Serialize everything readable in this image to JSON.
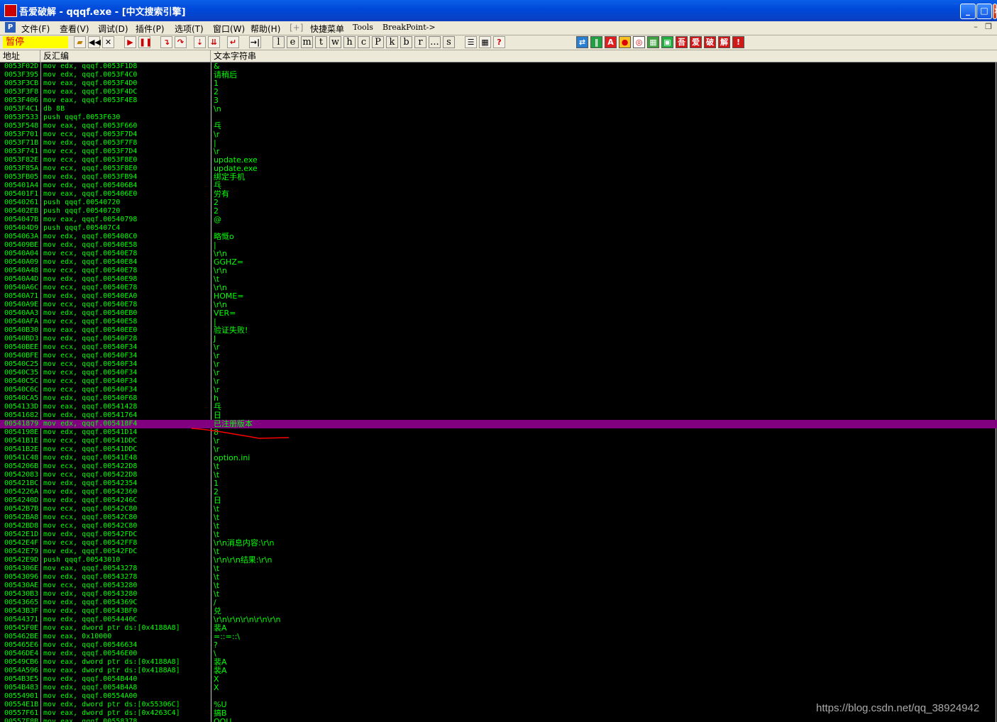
{
  "window": {
    "title": "吾爱破解 - qqqf.exe - [中文搜索引擎]",
    "icon_text": "吾爱破解"
  },
  "window_buttons": {
    "minimize": "_",
    "maximize": "□",
    "close": "×"
  },
  "menu": {
    "p_icon": "P",
    "items": [
      "文件(F)",
      "查看(V)",
      "调试(D)",
      "插件(P)",
      "选项(T)",
      "窗口(W)",
      "帮助(H)",
      "[+]",
      "快捷菜单",
      "Tools",
      "BreakPoint->"
    ],
    "mdi_min": "–",
    "mdi_restore": "❐"
  },
  "toolbar": {
    "status": "暂停",
    "buttons": [
      "open-icon",
      "rewind-icon",
      "close-icon",
      "run-icon",
      "pause-icon",
      "step-into-icon",
      "step-over-icon",
      "trace-into-icon",
      "trace-over-icon",
      "execute-till-return-icon",
      "goto-icon"
    ],
    "letters": [
      "l",
      "e",
      "m",
      "t",
      "w",
      "h",
      "c",
      "P",
      "k",
      "b",
      "r",
      "...",
      "s"
    ],
    "list_icons": [
      "list-icon",
      "memory-map-icon",
      "help-icon"
    ],
    "plugin_icons": [
      {
        "name": "refresh-icon",
        "text": "⇄",
        "bg": "#2a7fd0"
      },
      {
        "name": "patch-icon",
        "text": "‖",
        "bg": "#20a040"
      },
      {
        "name": "a-icon",
        "text": "A",
        "bg": "#e02020"
      },
      {
        "name": "record-icon",
        "text": "●",
        "bg": "#f8c020"
      },
      {
        "name": "target-icon",
        "text": "◎",
        "bg": "#ffffff"
      },
      {
        "name": "grid-icon",
        "text": "▦",
        "bg": "#40a040"
      },
      {
        "name": "window-icon",
        "text": "▣",
        "bg": "#20b040"
      },
      {
        "name": "wu-icon",
        "text": "吾",
        "bg": "#d01818"
      },
      {
        "name": "ai-icon",
        "text": "爱",
        "bg": "#d01818"
      },
      {
        "name": "po-icon",
        "text": "破",
        "bg": "#d01818"
      },
      {
        "name": "jie-icon",
        "text": "解",
        "bg": "#d01818"
      },
      {
        "name": "bang-icon",
        "text": "!",
        "bg": "#d01818"
      }
    ]
  },
  "columns": {
    "addr": "地址",
    "disasm": "反汇编",
    "string": "文本字符串"
  },
  "selected_row": 42,
  "colors": {
    "text": "#00ff00",
    "selection": "#800080",
    "annotation": "#ff0000"
  },
  "rows": [
    {
      "addr": "0053F02D",
      "dis": "mov edx, qqqf.0053F1D8",
      "str": "&"
    },
    {
      "addr": "0053F395",
      "dis": "mov edx, qqqf.0053F4C0",
      "str": "请稍后"
    },
    {
      "addr": "0053F3CB",
      "dis": "mov eax, qqqf.0053F4D0",
      "str": "1"
    },
    {
      "addr": "0053F3F8",
      "dis": "mov eax, qqqf.0053F4DC",
      "str": "2"
    },
    {
      "addr": "0053F406",
      "dis": "mov eax, qqqf.0053F4E8",
      "str": "3"
    },
    {
      "addr": "0053F4C1",
      "dis": "db 8B",
      "str": "\\n"
    },
    {
      "addr": "0053F533",
      "dis": "push qqqf.0053F630",
      "str": ""
    },
    {
      "addr": "0053F548",
      "dis": "mov eax, qqqf.0053F660",
      "str": "乓"
    },
    {
      "addr": "0053F701",
      "dis": "mov ecx, qqqf.0053F7D4",
      "str": "\\r"
    },
    {
      "addr": "0053F71B",
      "dis": "mov edx, qqqf.0053F7F8",
      "str": "|"
    },
    {
      "addr": "0053F741",
      "dis": "mov ecx, qqqf.0053F7D4",
      "str": "\\r"
    },
    {
      "addr": "0053F82E",
      "dis": "mov ecx, qqqf.0053F8E0",
      "str": "update.exe"
    },
    {
      "addr": "0053F85A",
      "dis": "mov ecx, qqqf.0053F8E0",
      "str": "update.exe"
    },
    {
      "addr": "0053FB05",
      "dis": "mov edx, qqqf.0053FB94",
      "str": "绑定手机"
    },
    {
      "addr": "005401A4",
      "dis": "mov edx, qqqf.005406B4",
      "str": "乓"
    },
    {
      "addr": "005401F1",
      "dis": "mov eax, qqqf.005406E0",
      "str": "労有"
    },
    {
      "addr": "00540261",
      "dis": "push qqqf.00540720",
      "str": "2"
    },
    {
      "addr": "005402EB",
      "dis": "push qqqf.00540720",
      "str": "2"
    },
    {
      "addr": "0054047B",
      "dis": "mov eax, qqqf.00540798",
      "str": "@"
    },
    {
      "addr": "005404D9",
      "dis": "push qqqf.005407C4",
      "str": ""
    },
    {
      "addr": "0054063A",
      "dis": "mov edx, qqqf.005408C0",
      "str": "略慨o"
    },
    {
      "addr": "005409BE",
      "dis": "mov edx, qqqf.00540E58",
      "str": "|"
    },
    {
      "addr": "00540A04",
      "dis": "mov ecx, qqqf.00540E78",
      "str": "\\r\\n"
    },
    {
      "addr": "00540A09",
      "dis": "mov edx, qqqf.00540E84",
      "str": "GGHZ="
    },
    {
      "addr": "00540A48",
      "dis": "mov ecx, qqqf.00540E78",
      "str": "\\r\\n"
    },
    {
      "addr": "00540A4D",
      "dis": "mov edx, qqqf.00540E98",
      "str": "\\t"
    },
    {
      "addr": "00540A6C",
      "dis": "mov ecx, qqqf.00540E78",
      "str": "\\r\\n"
    },
    {
      "addr": "00540A71",
      "dis": "mov edx, qqqf.00540EA0",
      "str": "HOME="
    },
    {
      "addr": "00540A9E",
      "dis": "mov ecx, qqqf.00540E78",
      "str": "\\r\\n"
    },
    {
      "addr": "00540AA3",
      "dis": "mov edx, qqqf.00540EB0",
      "str": "VER="
    },
    {
      "addr": "00540AFA",
      "dis": "mov ecx, qqqf.00540E58",
      "str": "|"
    },
    {
      "addr": "00540B30",
      "dis": "mov eax, qqqf.00540EE0",
      "str": "验证失败!"
    },
    {
      "addr": "00540BD3",
      "dis": "mov edx, qqqf.00540F28",
      "str": "J"
    },
    {
      "addr": "00540BEE",
      "dis": "mov ecx, qqqf.00540F34",
      "str": "\\r"
    },
    {
      "addr": "00540BFE",
      "dis": "mov ecx, qqqf.00540F34",
      "str": "\\r"
    },
    {
      "addr": "00540C25",
      "dis": "mov ecx, qqqf.00540F34",
      "str": "\\r"
    },
    {
      "addr": "00540C35",
      "dis": "mov ecx, qqqf.00540F34",
      "str": "\\r"
    },
    {
      "addr": "00540C5C",
      "dis": "mov ecx, qqqf.00540F34",
      "str": "\\r"
    },
    {
      "addr": "00540C6C",
      "dis": "mov ecx, qqqf.00540F34",
      "str": "\\r"
    },
    {
      "addr": "00540CA5",
      "dis": "mov edx, qqqf.00540F68",
      "str": "h"
    },
    {
      "addr": "0054133D",
      "dis": "mov eax, qqqf.00541428",
      "str": "乓"
    },
    {
      "addr": "00541682",
      "dis": "mov edx, qqqf.00541764",
      "str": "日"
    },
    {
      "addr": "00541879",
      "dis": "mov edx, qqqf.005418F4",
      "str": "已注册版本"
    },
    {
      "addr": "0054198E",
      "dis": "mov edx, qqqf.00541D14",
      "str": "8"
    },
    {
      "addr": "00541B1E",
      "dis": "mov ecx, qqqf.00541DDC",
      "str": "\\r"
    },
    {
      "addr": "00541B2E",
      "dis": "mov ecx, qqqf.00541DDC",
      "str": "\\r"
    },
    {
      "addr": "00541C48",
      "dis": "mov edx, qqqf.00541E48",
      "str": "option.ini"
    },
    {
      "addr": "0054206B",
      "dis": "mov ecx, qqqf.005422D8",
      "str": "\\t"
    },
    {
      "addr": "00542083",
      "dis": "mov ecx, qqqf.005422D8",
      "str": "\\t"
    },
    {
      "addr": "005421BC",
      "dis": "mov edx, qqqf.00542354",
      "str": "1"
    },
    {
      "addr": "0054226A",
      "dis": "mov edx, qqqf.00542360",
      "str": "2"
    },
    {
      "addr": "0054240D",
      "dis": "mov edx, qqqf.0054246C",
      "str": "日"
    },
    {
      "addr": "00542B7B",
      "dis": "mov ecx, qqqf.00542C80",
      "str": "\\t"
    },
    {
      "addr": "00542BA8",
      "dis": "mov ecx, qqqf.00542C80",
      "str": "\\t"
    },
    {
      "addr": "00542BD8",
      "dis": "mov ecx, qqqf.00542C80",
      "str": "\\t"
    },
    {
      "addr": "00542E1D",
      "dis": "mov edx, qqqf.00542FDC",
      "str": "\\t"
    },
    {
      "addr": "00542E4F",
      "dis": "mov ecx, qqqf.00542FF8",
      "str": "\\r\\n消息内容:\\r\\n"
    },
    {
      "addr": "00542E79",
      "dis": "mov edx, qqqf.00542FDC",
      "str": "\\t"
    },
    {
      "addr": "00542E9D",
      "dis": "push qqqf.00543010",
      "str": "\\r\\n\\r\\n结果:\\r\\n"
    },
    {
      "addr": "0054306E",
      "dis": "mov eax, qqqf.00543278",
      "str": "\\t"
    },
    {
      "addr": "00543096",
      "dis": "mov edx, qqqf.00543278",
      "str": "\\t"
    },
    {
      "addr": "005430AE",
      "dis": "mov ecx, qqqf.00543280",
      "str": "\\t"
    },
    {
      "addr": "005430B3",
      "dis": "mov edx, qqqf.00543280",
      "str": "\\t"
    },
    {
      "addr": "00543665",
      "dis": "mov edx, qqqf.0054369C",
      "str": "/"
    },
    {
      "addr": "00543B3F",
      "dis": "mov edx, qqqf.00543BF0",
      "str": "兑"
    },
    {
      "addr": "00544371",
      "dis": "mov edx, qqqf.0054440C",
      "str": "\\r\\n\\r\\n\\r\\n\\r\\n\\r\\n"
    },
    {
      "addr": "00545F0E",
      "dis": "mov eax, dword ptr ds:[0x4188A8]",
      "str": "裴A"
    },
    {
      "addr": "005462BE",
      "dis": "mov eax, 0x10000",
      "str": "=::=::\\"
    },
    {
      "addr": "005465E6",
      "dis": "mov edx, qqqf.00546634",
      "str": "?"
    },
    {
      "addr": "00546DE4",
      "dis": "mov edx, qqqf.00546E00",
      "str": "\\"
    },
    {
      "addr": "00549CB6",
      "dis": "mov eax, dword ptr ds:[0x4188A8]",
      "str": "裴A"
    },
    {
      "addr": "0054A596",
      "dis": "mov eax, dword ptr ds:[0x4188A8]",
      "str": "裴A"
    },
    {
      "addr": "0054B3E5",
      "dis": "mov edx, qqqf.0054B440",
      "str": "X"
    },
    {
      "addr": "0054B483",
      "dis": "mov edx, qqqf.0054B4A8",
      "str": "X"
    },
    {
      "addr": "00554901",
      "dis": "mov edx, qqqf.00554A00",
      "str": ""
    },
    {
      "addr": "00554E1B",
      "dis": "mov edx, dword ptr ds:[0x55306C]",
      "str": "%U"
    },
    {
      "addr": "00557F61",
      "dis": "mov eax, dword ptr ds:[0x4263C4]",
      "str": "搞B"
    },
    {
      "addr": "00557F8B",
      "dis": "mov eax, qqqf.00558378",
      "str": "OOU"
    }
  ],
  "watermark": "https://blog.csdn.net/qq_38924942"
}
